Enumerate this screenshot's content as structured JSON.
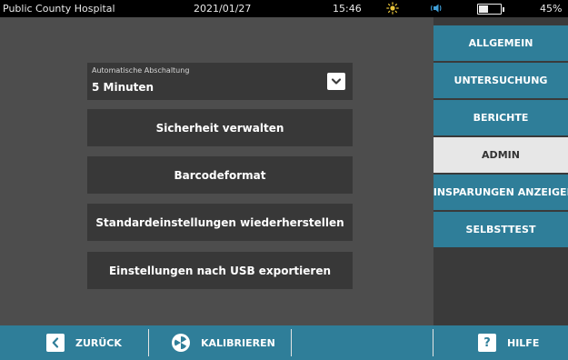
{
  "status": {
    "hospital": "Public County Hospital",
    "date": "2021/01/27",
    "time": "15:46",
    "battery_percent": "45%",
    "battery_level": 0.45,
    "icons": [
      "brightness-icon",
      "volume-icon",
      "battery-icon"
    ]
  },
  "main": {
    "auto_shutdown": {
      "label": "Automatische Abschaltung",
      "value": "5 Minuten"
    },
    "buttons": {
      "security": "Sicherheit verwalten",
      "barcode": "Barcodeformat",
      "restore_defaults": "Standardeinstellungen wiederherstellen",
      "export_usb": "Einstellungen nach USB exportieren"
    }
  },
  "sidebar": {
    "items": [
      {
        "label": "ALLGEMEIN",
        "active": false
      },
      {
        "label": "UNTERSUCHUNG",
        "active": false
      },
      {
        "label": "BERICHTE",
        "active": false
      },
      {
        "label": "ADMIN",
        "active": true
      },
      {
        "label": "EINSPARUNGEN ANZEIGEN",
        "active": false
      },
      {
        "label": "SELBSTTEST",
        "active": false
      }
    ]
  },
  "bottombar": {
    "back_label": "ZURÜCK",
    "calibrate_label": "KALIBRIEREN",
    "help_label": "HILFE",
    "help_icon_glyph": "?",
    "back_icon_glyph": "‹"
  },
  "colors": {
    "accent": "#2f7e99",
    "panel": "#4d4d4d",
    "button": "#383838",
    "active_tab": "#e7e7e7",
    "status_sun": "#e8c43a",
    "status_volume": "#3f9fd8"
  }
}
